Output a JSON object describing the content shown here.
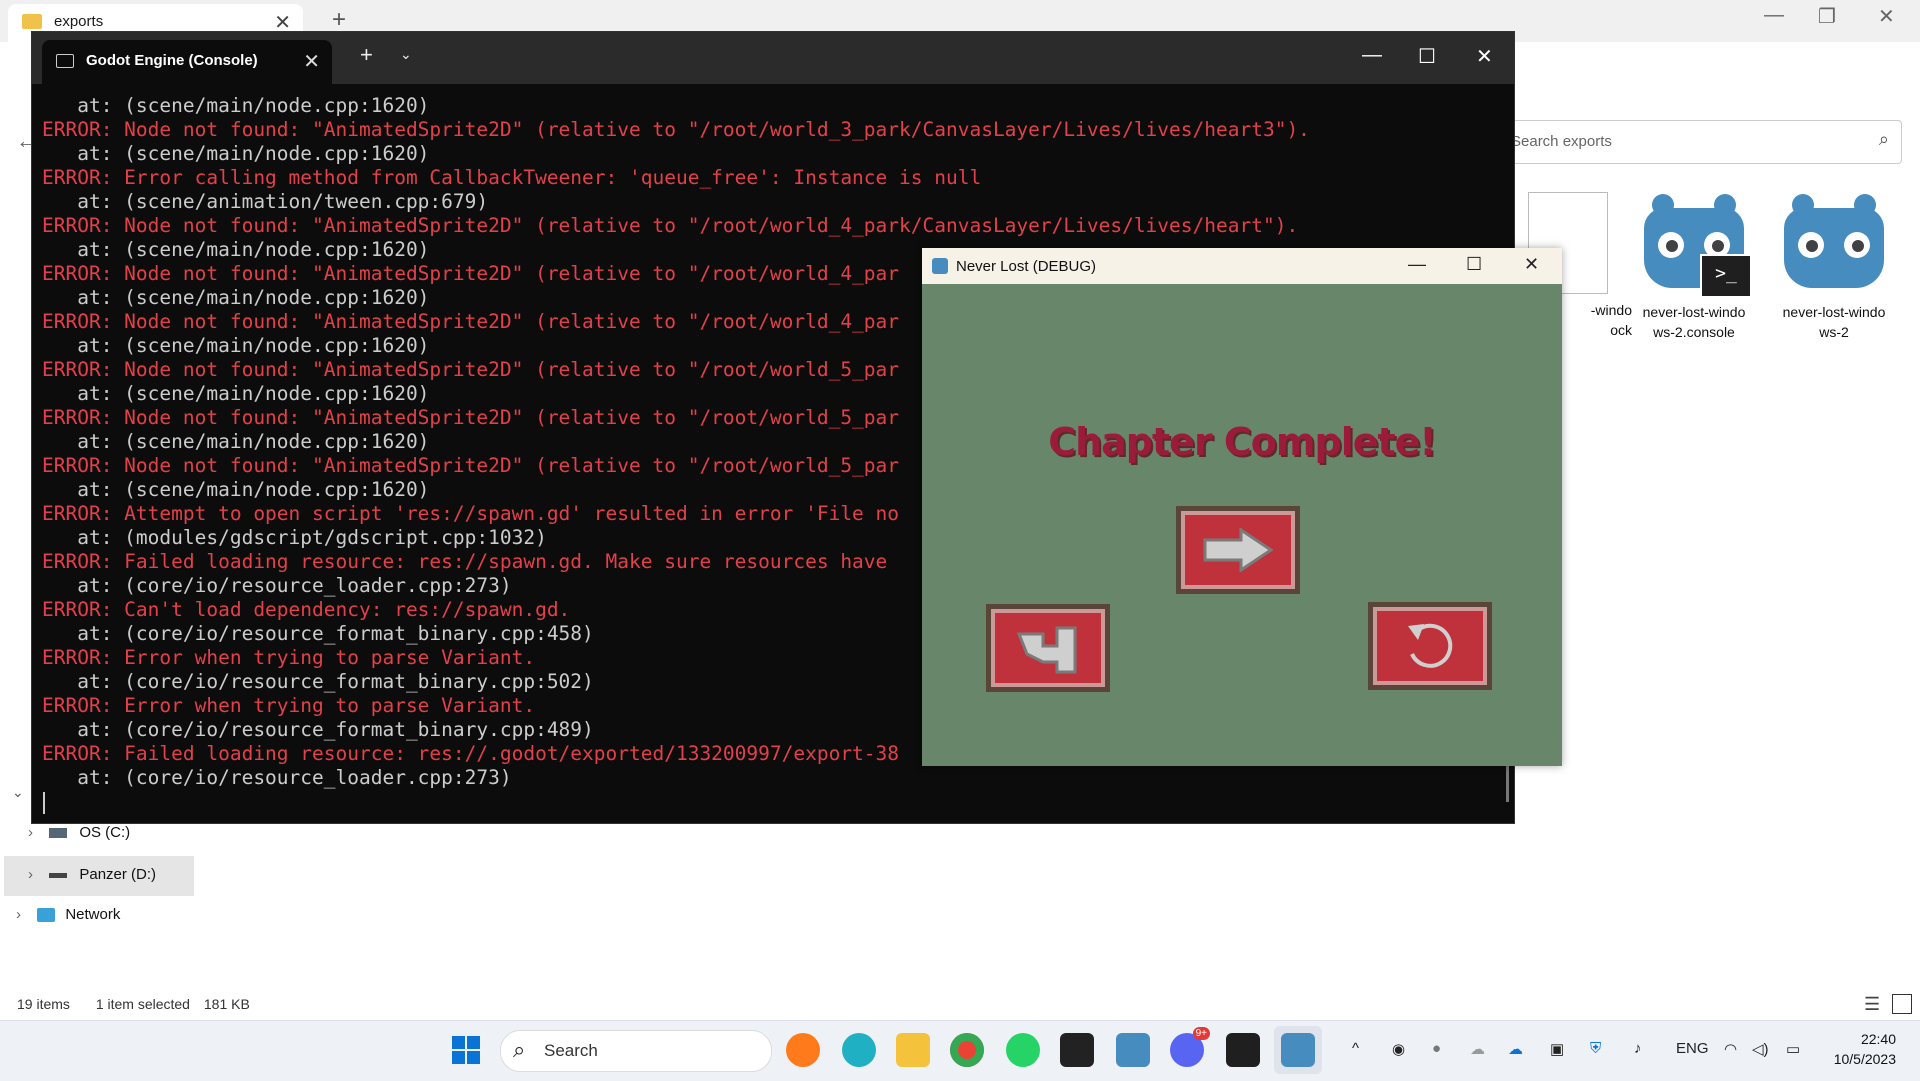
{
  "explorer": {
    "tab_title": "exports",
    "search_placeholder": "Search exports",
    "files": [
      {
        "label_line1": "-windo",
        "label_line2": "ock"
      },
      {
        "label_line1": "never-lost-windo",
        "label_line2": "ws-2.console"
      },
      {
        "label_line1": "never-lost-windo",
        "label_line2": "ws-2"
      }
    ],
    "sidebar": {
      "drives": [
        {
          "label": "OS (C:)"
        },
        {
          "label": "Panzer (D:)"
        },
        {
          "label": "Network"
        }
      ]
    },
    "status": {
      "items": "19 items",
      "selected": "1 item selected",
      "size": "181 KB"
    }
  },
  "console": {
    "tab_title": "Godot Engine (Console)",
    "lines": [
      {
        "kind": "at",
        "text": "   at: (scene/main/node.cpp:1620)"
      },
      {
        "kind": "err",
        "text": "ERROR: Node not found: \"AnimatedSprite2D\" (relative to \"/root/world_3_park/CanvasLayer/Lives/lives/heart3\")."
      },
      {
        "kind": "at",
        "text": "   at: (scene/main/node.cpp:1620)"
      },
      {
        "kind": "err",
        "text": "ERROR: Error calling method from CallbackTweener: 'queue_free': Instance is null"
      },
      {
        "kind": "at",
        "text": "   at: (scene/animation/tween.cpp:679)"
      },
      {
        "kind": "err",
        "text": "ERROR: Node not found: \"AnimatedSprite2D\" (relative to \"/root/world_4_park/CanvasLayer/Lives/lives/heart\")."
      },
      {
        "kind": "at",
        "text": "   at: (scene/main/node.cpp:1620)"
      },
      {
        "kind": "err",
        "text": "ERROR: Node not found: \"AnimatedSprite2D\" (relative to \"/root/world_4_par"
      },
      {
        "kind": "at",
        "text": "   at: (scene/main/node.cpp:1620)"
      },
      {
        "kind": "err",
        "text": "ERROR: Node not found: \"AnimatedSprite2D\" (relative to \"/root/world_4_par"
      },
      {
        "kind": "at",
        "text": "   at: (scene/main/node.cpp:1620)"
      },
      {
        "kind": "err",
        "text": "ERROR: Node not found: \"AnimatedSprite2D\" (relative to \"/root/world_5_par"
      },
      {
        "kind": "at",
        "text": "   at: (scene/main/node.cpp:1620)"
      },
      {
        "kind": "err",
        "text": "ERROR: Node not found: \"AnimatedSprite2D\" (relative to \"/root/world_5_par"
      },
      {
        "kind": "at",
        "text": "   at: (scene/main/node.cpp:1620)"
      },
      {
        "kind": "err",
        "text": "ERROR: Node not found: \"AnimatedSprite2D\" (relative to \"/root/world_5_par"
      },
      {
        "kind": "at",
        "text": "   at: (scene/main/node.cpp:1620)"
      },
      {
        "kind": "err",
        "text": "ERROR: Attempt to open script 'res://spawn.gd' resulted in error 'File no"
      },
      {
        "kind": "at",
        "text": "   at: (modules/gdscript/gdscript.cpp:1032)"
      },
      {
        "kind": "err",
        "text": "ERROR: Failed loading resource: res://spawn.gd. Make sure resources have"
      },
      {
        "kind": "at",
        "text": "   at: (core/io/resource_loader.cpp:273)"
      },
      {
        "kind": "err",
        "text": "ERROR: Can't load dependency: res://spawn.gd."
      },
      {
        "kind": "at",
        "text": "   at: (core/io/resource_format_binary.cpp:458)"
      },
      {
        "kind": "err",
        "text": "ERROR: Error when trying to parse Variant."
      },
      {
        "kind": "at",
        "text": "   at: (core/io/resource_format_binary.cpp:502)"
      },
      {
        "kind": "err",
        "text": "ERROR: Error when trying to parse Variant."
      },
      {
        "kind": "at",
        "text": "   at: (core/io/resource_format_binary.cpp:489)"
      },
      {
        "kind": "err",
        "text": "ERROR: Failed loading resource: res://.godot/exported/133200997/export-38"
      },
      {
        "kind": "at",
        "text": "   at: (core/io/resource_loader.cpp:273)"
      }
    ]
  },
  "game": {
    "title": "Never Lost (DEBUG)",
    "heading": "Chapter Complete!"
  },
  "taskbar": {
    "search_placeholder": "Search",
    "lang": "ENG",
    "time": "22:40",
    "date": "10/5/2023",
    "discord_badge": "9+"
  },
  "colors": {
    "error_red": "#e2404a",
    "game_bg": "#67866a",
    "button_red": "#c0323b",
    "heading_red": "#9b1b3b"
  }
}
